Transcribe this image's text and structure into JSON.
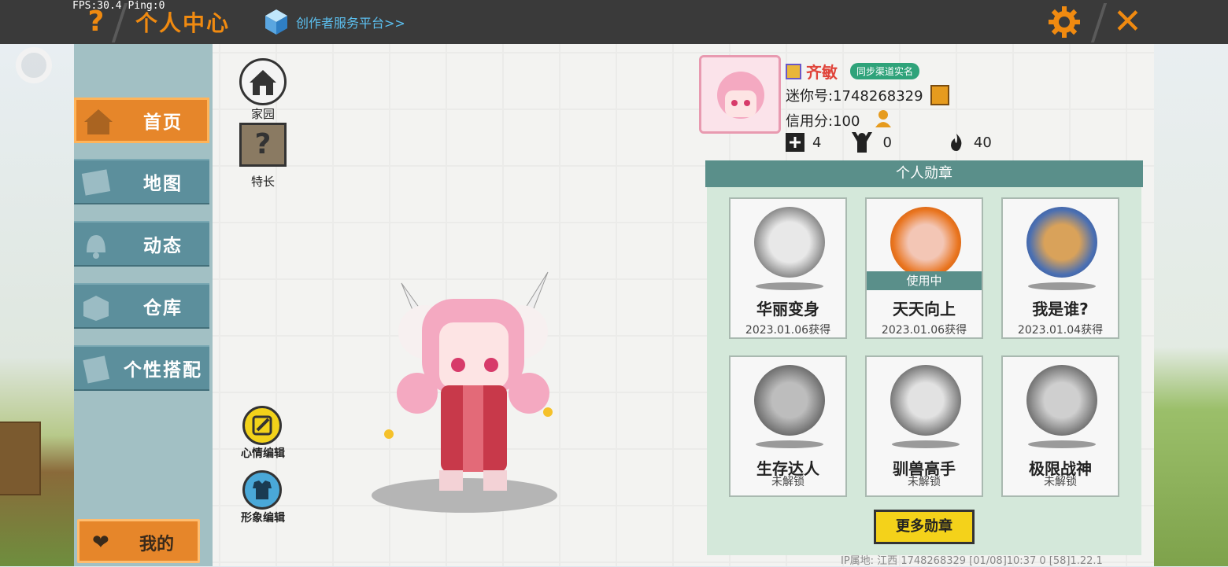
{
  "debug": {
    "fps": "FPS:30.4",
    "ping": "Ping:0"
  },
  "header": {
    "title": "个人中心",
    "creator_link": "创作者服务平台>>",
    "colors": {
      "accent": "#f08a10",
      "bar": "#3a3a3a",
      "link": "#5cc0f0"
    }
  },
  "nav": {
    "items": [
      {
        "label": "首页",
        "active": true,
        "icon": "house-icon"
      },
      {
        "label": "地图",
        "active": false,
        "icon": "map-icon"
      },
      {
        "label": "动态",
        "active": false,
        "icon": "bell-icon"
      },
      {
        "label": "仓库",
        "active": false,
        "icon": "box-icon"
      },
      {
        "label": "个性搭配",
        "active": false,
        "icon": "wardrobe-icon"
      }
    ],
    "mine": "我的"
  },
  "quick": {
    "home": "家园",
    "talent": "特长",
    "mood": "心情编辑",
    "look": "形象编辑"
  },
  "profile": {
    "name": "齐敏",
    "sync": "同步渠道实名",
    "mini_id": "迷你号:1748268329",
    "credit": "信用分:100",
    "stats": {
      "flags": "4",
      "fans": "0",
      "fire": "40"
    }
  },
  "medals": {
    "header": "个人勋章",
    "in_use": "使用中",
    "items": [
      {
        "name": "华丽变身",
        "date": "2023.01.06获得"
      },
      {
        "name": "天天向上",
        "date": "2023.01.06获得",
        "in_use": true
      },
      {
        "name": "我是谁?",
        "date": "2023.01.04获得"
      },
      {
        "name": "生存达人",
        "date": "未解锁"
      },
      {
        "name": "驯兽高手",
        "date": "未解锁"
      },
      {
        "name": "极限战神",
        "date": "未解锁"
      }
    ],
    "more": "更多勋章"
  },
  "footer": "IP属地: 江西  1748268329  [01/08]10:37 0  [58]1.22.1"
}
